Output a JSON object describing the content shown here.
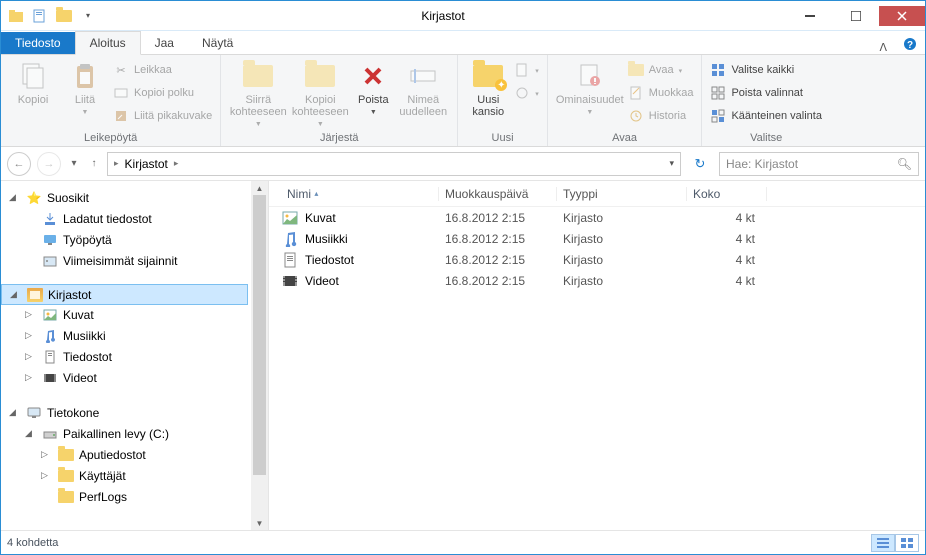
{
  "window": {
    "title": "Kirjastot"
  },
  "tabs": {
    "file": "Tiedosto",
    "home": "Aloitus",
    "share": "Jaa",
    "view": "Näytä"
  },
  "ribbon": {
    "clipboard": {
      "copy": "Kopioi",
      "paste": "Liitä",
      "cut": "Leikkaa",
      "copy_path": "Kopioi polku",
      "paste_shortcut": "Liitä pikakuvake",
      "group": "Leikepöytä"
    },
    "organize": {
      "move_to": "Siirrä kohteeseen",
      "copy_to": "Kopioi kohteeseen",
      "delete": "Poista",
      "rename": "Nimeä uudelleen",
      "group": "Järjestä"
    },
    "new": {
      "new_folder": "Uusi kansio",
      "group": "Uusi"
    },
    "open": {
      "properties": "Ominaisuudet",
      "open": "Avaa",
      "edit": "Muokkaa",
      "history": "Historia",
      "group": "Avaa"
    },
    "select": {
      "select_all": "Valitse kaikki",
      "select_none": "Poista valinnat",
      "invert": "Käänteinen valinta",
      "group": "Valitse"
    }
  },
  "nav": {
    "location": "Kirjastot",
    "search_placeholder": "Hae: Kirjastot"
  },
  "tree": {
    "favorites": "Suosikit",
    "downloads": "Ladatut tiedostot",
    "desktop": "Työpöytä",
    "recent": "Viimeisimmät sijainnit",
    "libraries": "Kirjastot",
    "pictures": "Kuvat",
    "music": "Musiikki",
    "documents": "Tiedostot",
    "videos": "Videot",
    "computer": "Tietokone",
    "local_disk": "Paikallinen levy (C:)",
    "aputiedostot": "Aputiedostot",
    "users": "Käyttäjät",
    "perflogs": "PerfLogs"
  },
  "columns": {
    "name": "Nimi",
    "modified": "Muokkauspäivä",
    "type": "Tyyppi",
    "size": "Koko"
  },
  "items": [
    {
      "icon": "pictures",
      "name": "Kuvat",
      "modified": "16.8.2012 2:15",
      "type": "Kirjasto",
      "size": "4 kt"
    },
    {
      "icon": "music",
      "name": "Musiikki",
      "modified": "16.8.2012 2:15",
      "type": "Kirjasto",
      "size": "4 kt"
    },
    {
      "icon": "documents",
      "name": "Tiedostot",
      "modified": "16.8.2012 2:15",
      "type": "Kirjasto",
      "size": "4 kt"
    },
    {
      "icon": "videos",
      "name": "Videot",
      "modified": "16.8.2012 2:15",
      "type": "Kirjasto",
      "size": "4 kt"
    }
  ],
  "status": {
    "count": "4 kohdetta"
  }
}
